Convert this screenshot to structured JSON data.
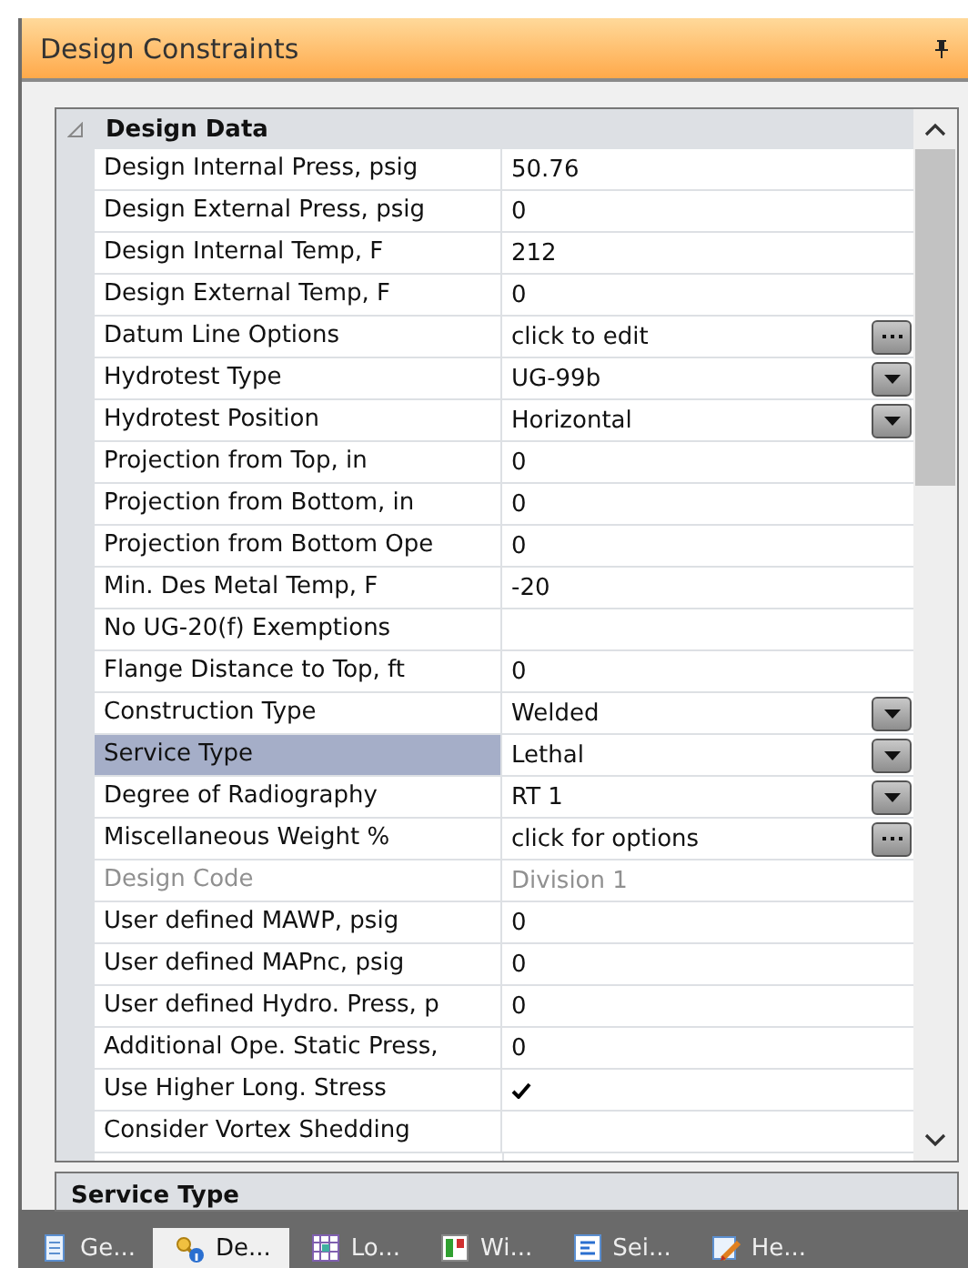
{
  "panel": {
    "title": "Design Constraints"
  },
  "category": {
    "label": "Design Data",
    "expanded": true
  },
  "rows": [
    {
      "label": "Design Internal Press, psig",
      "value": "50.76",
      "kind": "text",
      "selected": false,
      "disabled": false
    },
    {
      "label": "Design External Press, psig",
      "value": "0",
      "kind": "text",
      "selected": false,
      "disabled": false
    },
    {
      "label": "Design Internal Temp, F",
      "value": "212",
      "kind": "text",
      "selected": false,
      "disabled": false
    },
    {
      "label": "Design External Temp, F",
      "value": "0",
      "kind": "text",
      "selected": false,
      "disabled": false
    },
    {
      "label": "Datum Line Options",
      "value": "click to edit",
      "kind": "ellipsis",
      "selected": false,
      "disabled": false
    },
    {
      "label": "Hydrotest Type",
      "value": "UG-99b",
      "kind": "dropdown",
      "selected": false,
      "disabled": false
    },
    {
      "label": "Hydrotest Position",
      "value": "Horizontal",
      "kind": "dropdown",
      "selected": false,
      "disabled": false
    },
    {
      "label": "Projection from Top, in",
      "value": "0",
      "kind": "text",
      "selected": false,
      "disabled": false
    },
    {
      "label": "Projection from Bottom, in",
      "value": "0",
      "kind": "text",
      "selected": false,
      "disabled": false
    },
    {
      "label": "Projection from Bottom Ope",
      "value": "0",
      "kind": "text",
      "selected": false,
      "disabled": false
    },
    {
      "label": "Min. Des Metal Temp, F",
      "value": "-20",
      "kind": "text",
      "selected": false,
      "disabled": false
    },
    {
      "label": "No UG-20(f) Exemptions",
      "kind": "check",
      "checked": false,
      "selected": false,
      "disabled": false
    },
    {
      "label": "Flange Distance to Top, ft",
      "value": "0",
      "kind": "text",
      "selected": false,
      "disabled": false
    },
    {
      "label": "Construction Type",
      "value": "Welded",
      "kind": "dropdown",
      "selected": false,
      "disabled": false
    },
    {
      "label": "Service Type",
      "value": "Lethal",
      "kind": "dropdown",
      "selected": true,
      "disabled": false
    },
    {
      "label": "Degree of Radiography",
      "value": "RT 1",
      "kind": "dropdown",
      "selected": false,
      "disabled": false
    },
    {
      "label": "Miscellaneous Weight %",
      "value": "click for options",
      "kind": "ellipsis",
      "selected": false,
      "disabled": false
    },
    {
      "label": "Design Code",
      "value": "Division 1",
      "kind": "text",
      "selected": false,
      "disabled": true
    },
    {
      "label": "User defined MAWP, psig",
      "value": "0",
      "kind": "text",
      "selected": false,
      "disabled": false
    },
    {
      "label": "User defined MAPnc, psig",
      "value": "0",
      "kind": "text",
      "selected": false,
      "disabled": false
    },
    {
      "label": "User defined Hydro. Press, p",
      "value": "0",
      "kind": "text",
      "selected": false,
      "disabled": false
    },
    {
      "label": "Additional Ope. Static Press,",
      "value": "0",
      "kind": "text",
      "selected": false,
      "disabled": false
    },
    {
      "label": "Use Higher Long. Stress",
      "kind": "check",
      "checked": true,
      "selected": false,
      "disabled": false
    },
    {
      "label": "Consider Vortex Shedding",
      "kind": "check",
      "checked": false,
      "selected": false,
      "disabled": false
    }
  ],
  "description": {
    "title": "Service Type"
  },
  "tabs": [
    {
      "label": "Ge...",
      "selected": false
    },
    {
      "label": "De...",
      "selected": true
    },
    {
      "label": "Lo...",
      "selected": false
    },
    {
      "label": "Wi...",
      "selected": false
    },
    {
      "label": "Sei...",
      "selected": false
    },
    {
      "label": "He...",
      "selected": false
    }
  ]
}
